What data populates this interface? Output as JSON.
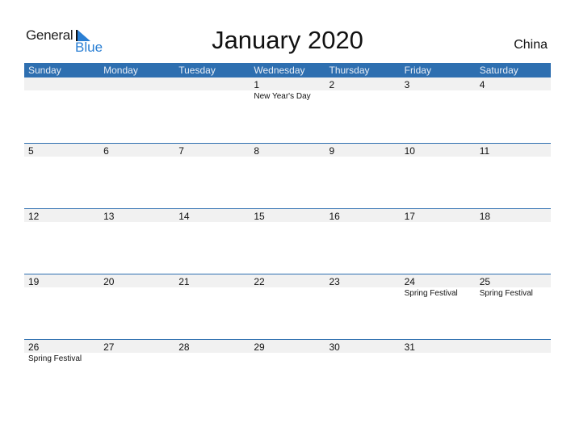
{
  "logo": {
    "general": "General",
    "blue": "Blue",
    "accent": "#2a7fd4"
  },
  "title": "January 2020",
  "country": "China",
  "colors": {
    "header_bg": "#2e6fb0",
    "date_bar": "#f1f1f1"
  },
  "weekdays": [
    "Sunday",
    "Monday",
    "Tuesday",
    "Wednesday",
    "Thursday",
    "Friday",
    "Saturday"
  ],
  "weeks": [
    [
      {
        "day": "",
        "holiday": ""
      },
      {
        "day": "",
        "holiday": ""
      },
      {
        "day": "",
        "holiday": ""
      },
      {
        "day": "1",
        "holiday": "New Year's Day"
      },
      {
        "day": "2",
        "holiday": ""
      },
      {
        "day": "3",
        "holiday": ""
      },
      {
        "day": "4",
        "holiday": ""
      }
    ],
    [
      {
        "day": "5",
        "holiday": ""
      },
      {
        "day": "6",
        "holiday": ""
      },
      {
        "day": "7",
        "holiday": ""
      },
      {
        "day": "8",
        "holiday": ""
      },
      {
        "day": "9",
        "holiday": ""
      },
      {
        "day": "10",
        "holiday": ""
      },
      {
        "day": "11",
        "holiday": ""
      }
    ],
    [
      {
        "day": "12",
        "holiday": ""
      },
      {
        "day": "13",
        "holiday": ""
      },
      {
        "day": "14",
        "holiday": ""
      },
      {
        "day": "15",
        "holiday": ""
      },
      {
        "day": "16",
        "holiday": ""
      },
      {
        "day": "17",
        "holiday": ""
      },
      {
        "day": "18",
        "holiday": ""
      }
    ],
    [
      {
        "day": "19",
        "holiday": ""
      },
      {
        "day": "20",
        "holiday": ""
      },
      {
        "day": "21",
        "holiday": ""
      },
      {
        "day": "22",
        "holiday": ""
      },
      {
        "day": "23",
        "holiday": ""
      },
      {
        "day": "24",
        "holiday": "Spring Festival"
      },
      {
        "day": "25",
        "holiday": "Spring Festival"
      }
    ],
    [
      {
        "day": "26",
        "holiday": "Spring Festival"
      },
      {
        "day": "27",
        "holiday": ""
      },
      {
        "day": "28",
        "holiday": ""
      },
      {
        "day": "29",
        "holiday": ""
      },
      {
        "day": "30",
        "holiday": ""
      },
      {
        "day": "31",
        "holiday": ""
      },
      {
        "day": "",
        "holiday": ""
      }
    ]
  ]
}
